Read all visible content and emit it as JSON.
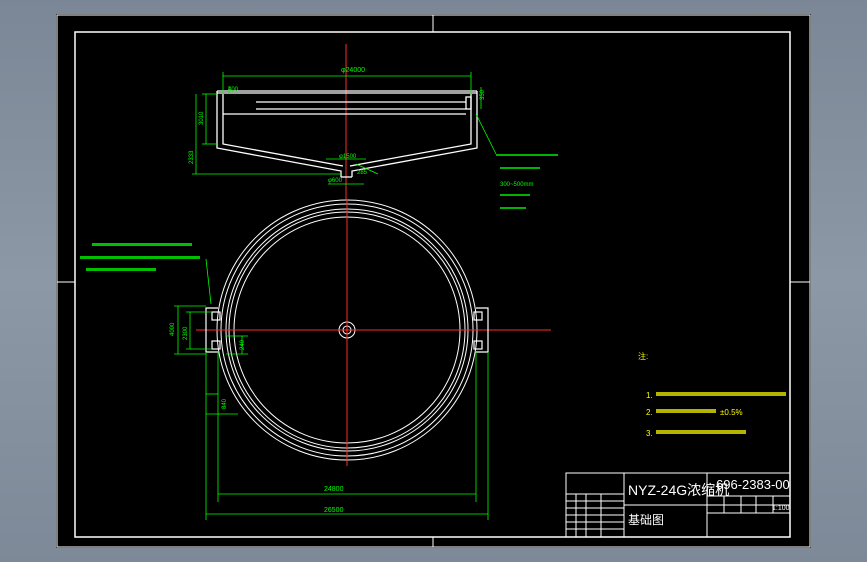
{
  "drawing": {
    "title_block": {
      "product": "NYZ-24G浓缩机",
      "drawing_number": "696-2383-00",
      "drawing_type": "基础图",
      "scale": "1:100"
    },
    "dimensions": {
      "top_diameter": "φ24000",
      "rim_400": "400",
      "right_350": "350",
      "depth_3010": "3010",
      "depth_2333": "2333",
      "center_1500": "φ1500",
      "outlet_600": "φ600",
      "offset_285": "285",
      "pad_4000": "4000",
      "pad_2300": "2300",
      "pad_240": "240",
      "pad_840": "840",
      "width_24800": "24800",
      "width_26500": "26500"
    },
    "callouts": {
      "right_depth_range": "300~500mm"
    },
    "notes": {
      "title": "注:",
      "items": [
        "1.",
        "2.",
        "3."
      ],
      "tolerance": "±0.5%"
    }
  },
  "colors": {
    "background": "#000000",
    "frame": "#ffffff",
    "outline": "#ffffff",
    "dimension": "#00ff00",
    "centerline": "#ff0000",
    "note_text": "#ffff00"
  }
}
